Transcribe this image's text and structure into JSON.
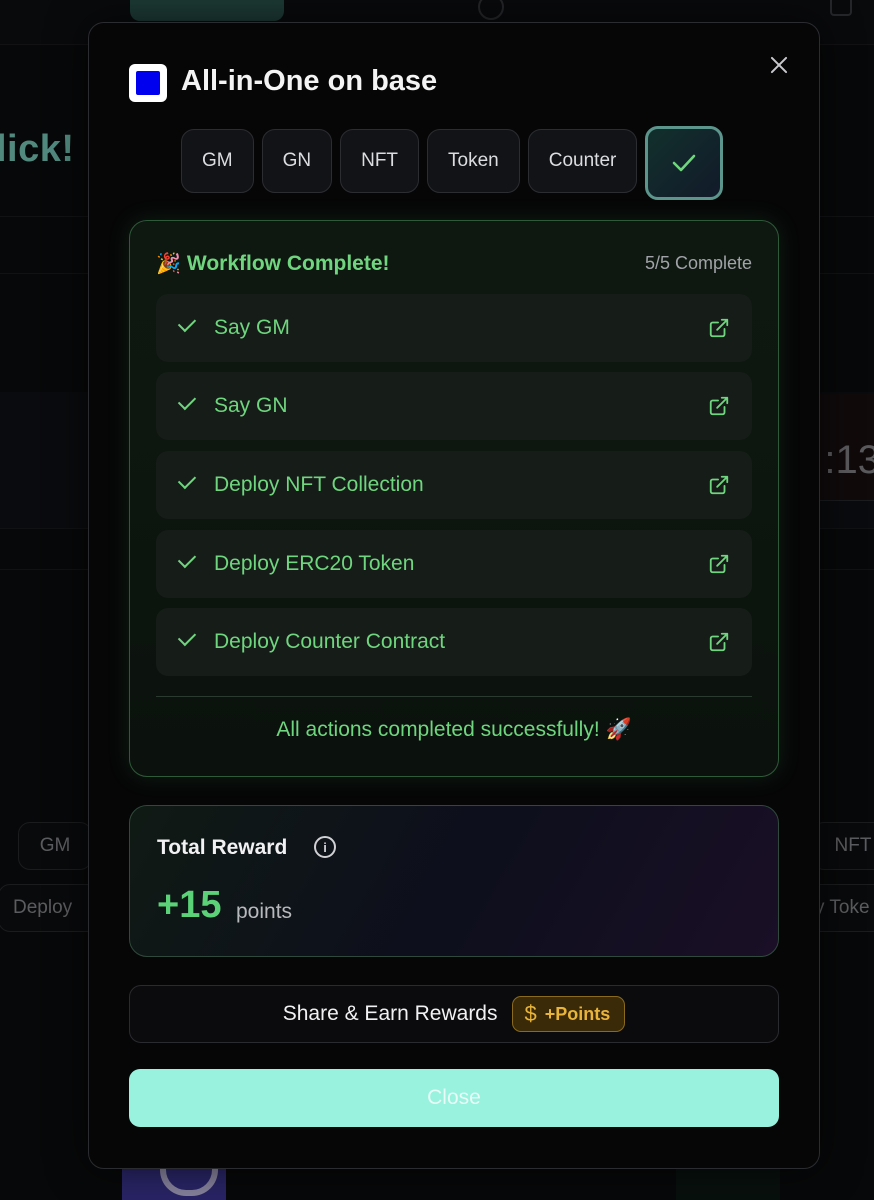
{
  "background": {
    "heading": "lick!",
    "time_fragment": ":13",
    "pill_left_top": "GM",
    "pill_left_bottom": "Deploy",
    "pill_right_top": "NFT",
    "pill_right_bottom": "y Toke"
  },
  "modal": {
    "title": "All-in-One on base",
    "tabs": [
      {
        "label": "GM"
      },
      {
        "label": "GN"
      },
      {
        "label": "NFT"
      },
      {
        "label": "Token"
      },
      {
        "label": "Counter"
      }
    ],
    "workflow": {
      "heading": "Workflow Complete!",
      "progress": "5/5 Complete",
      "items": [
        {
          "label": "Say GM"
        },
        {
          "label": "Say GN"
        },
        {
          "label": "Deploy NFT Collection"
        },
        {
          "label": "Deploy ERC20 Token"
        },
        {
          "label": "Deploy Counter Contract"
        }
      ],
      "footer": "All actions completed successfully! 🚀"
    },
    "reward": {
      "title": "Total Reward",
      "value": "+15",
      "unit": "points"
    },
    "share": {
      "label": "Share & Earn Rewards",
      "badge_icon": "$",
      "badge": "+Points"
    },
    "close_label": "Close"
  },
  "colors": {
    "accent_green": "#6fd57e",
    "close_button": "#98f2de",
    "badge_gold": "#e8b43a",
    "logo_blue": "#0000ee"
  }
}
